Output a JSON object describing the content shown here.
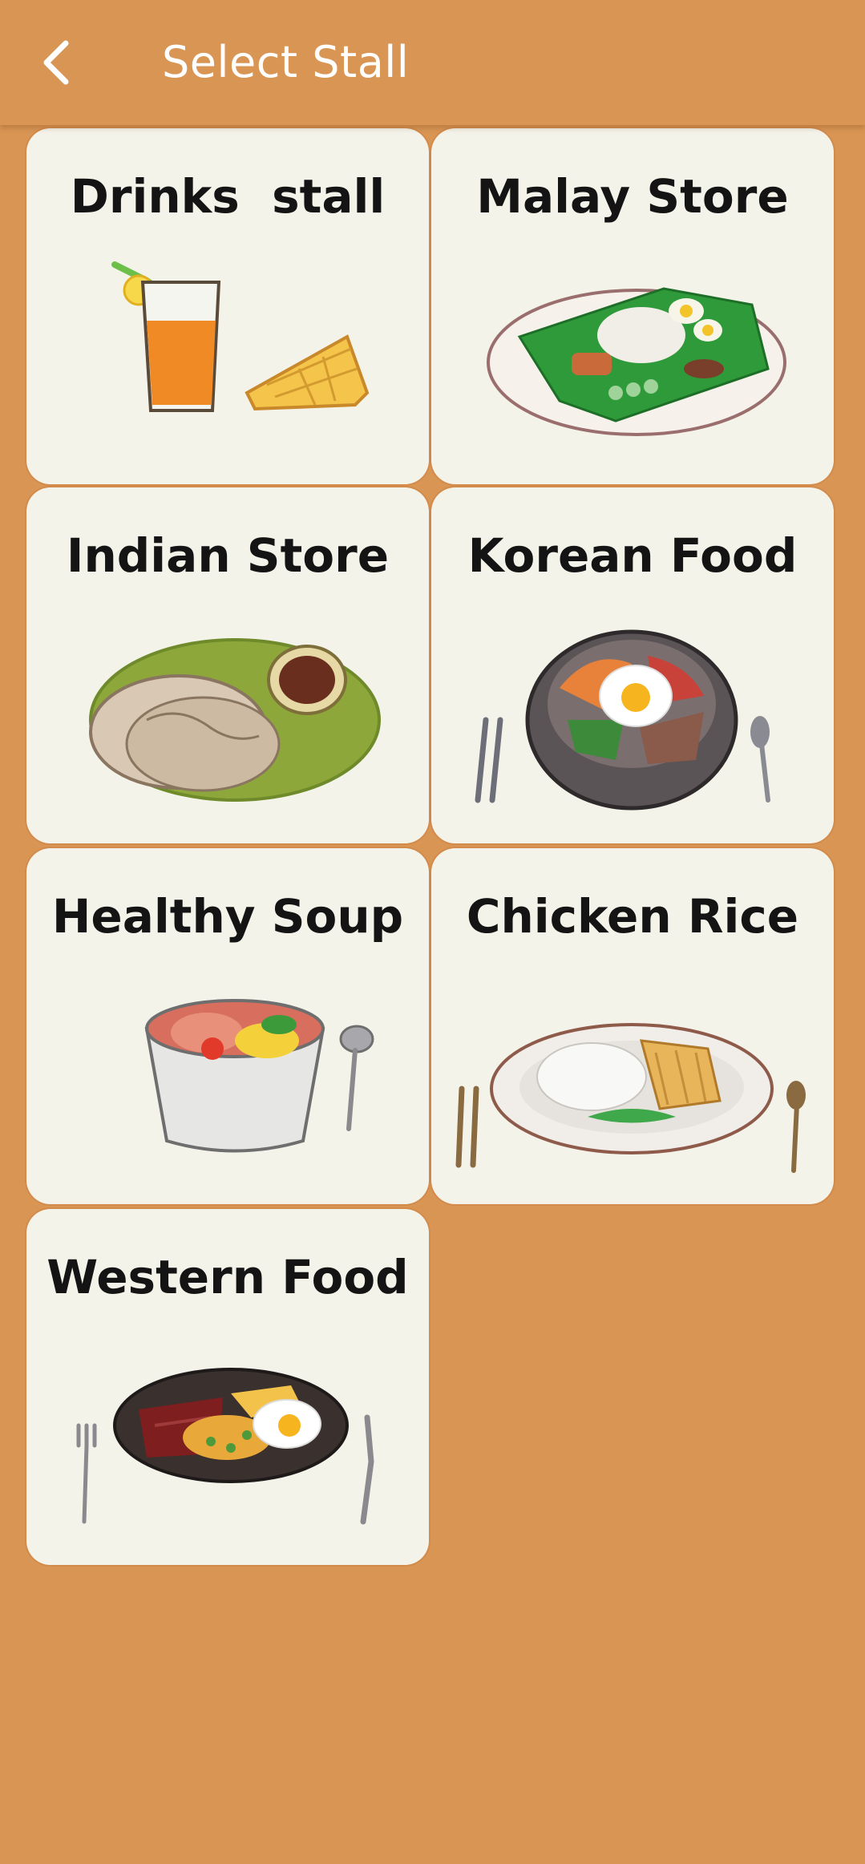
{
  "appbar": {
    "title": "Select Stall",
    "back_icon": "chevron-left-icon"
  },
  "colors": {
    "background": "#D99554",
    "card": "#F4F3EA",
    "title_text": "#FFFFFF",
    "label_text": "#141414"
  },
  "stalls": [
    {
      "label": "Drinks  stall",
      "icon": "drink-and-waffle-illustration"
    },
    {
      "label": "Malay Store",
      "icon": "nasi-lemak-illustration"
    },
    {
      "label": "Indian Store",
      "icon": "prata-and-curry-illustration"
    },
    {
      "label": "Korean Food",
      "icon": "bibimbap-illustration"
    },
    {
      "label": "Healthy Soup",
      "icon": "soup-bowl-illustration"
    },
    {
      "label": "Chicken Rice",
      "icon": "chicken-rice-illustration"
    },
    {
      "label": "Western Food",
      "icon": "steak-plate-illustration"
    }
  ]
}
